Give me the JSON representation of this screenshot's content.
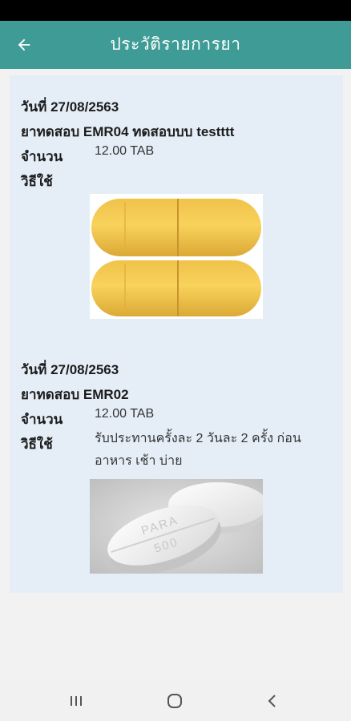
{
  "app_bar": {
    "title": "ประวัติรายการยา",
    "back_icon": "arrow-left-icon"
  },
  "colors": {
    "primary": "#3f9b95",
    "card_background": "#e5eef7",
    "capsule": "#f5c94c"
  },
  "labels": {
    "amount": "จำนวน",
    "usage": "วิธีใช้"
  },
  "records": [
    {
      "date": "วันที่ 27/08/2563",
      "drug": "ยาทดสอบ EMR04 ทดสอบบบ testttt",
      "amount": "12.00 TAB",
      "usage": "",
      "image": "yellow-capsule-image"
    },
    {
      "date": "วันที่ 27/08/2563",
      "drug": "ยาทดสอบ EMR02",
      "amount": "12.00 TAB",
      "usage": "รับประทานครั้งละ 2 วันละ 2 ครั้ง ก่อนอาหาร เช้า บ่าย",
      "image": "white-tablet-image",
      "tablet_imprint_top": "PARA",
      "tablet_imprint_bottom": "500"
    }
  ],
  "nav": {
    "recent_icon": "recent-apps-icon",
    "home_icon": "home-icon",
    "back_icon": "system-back-icon"
  }
}
